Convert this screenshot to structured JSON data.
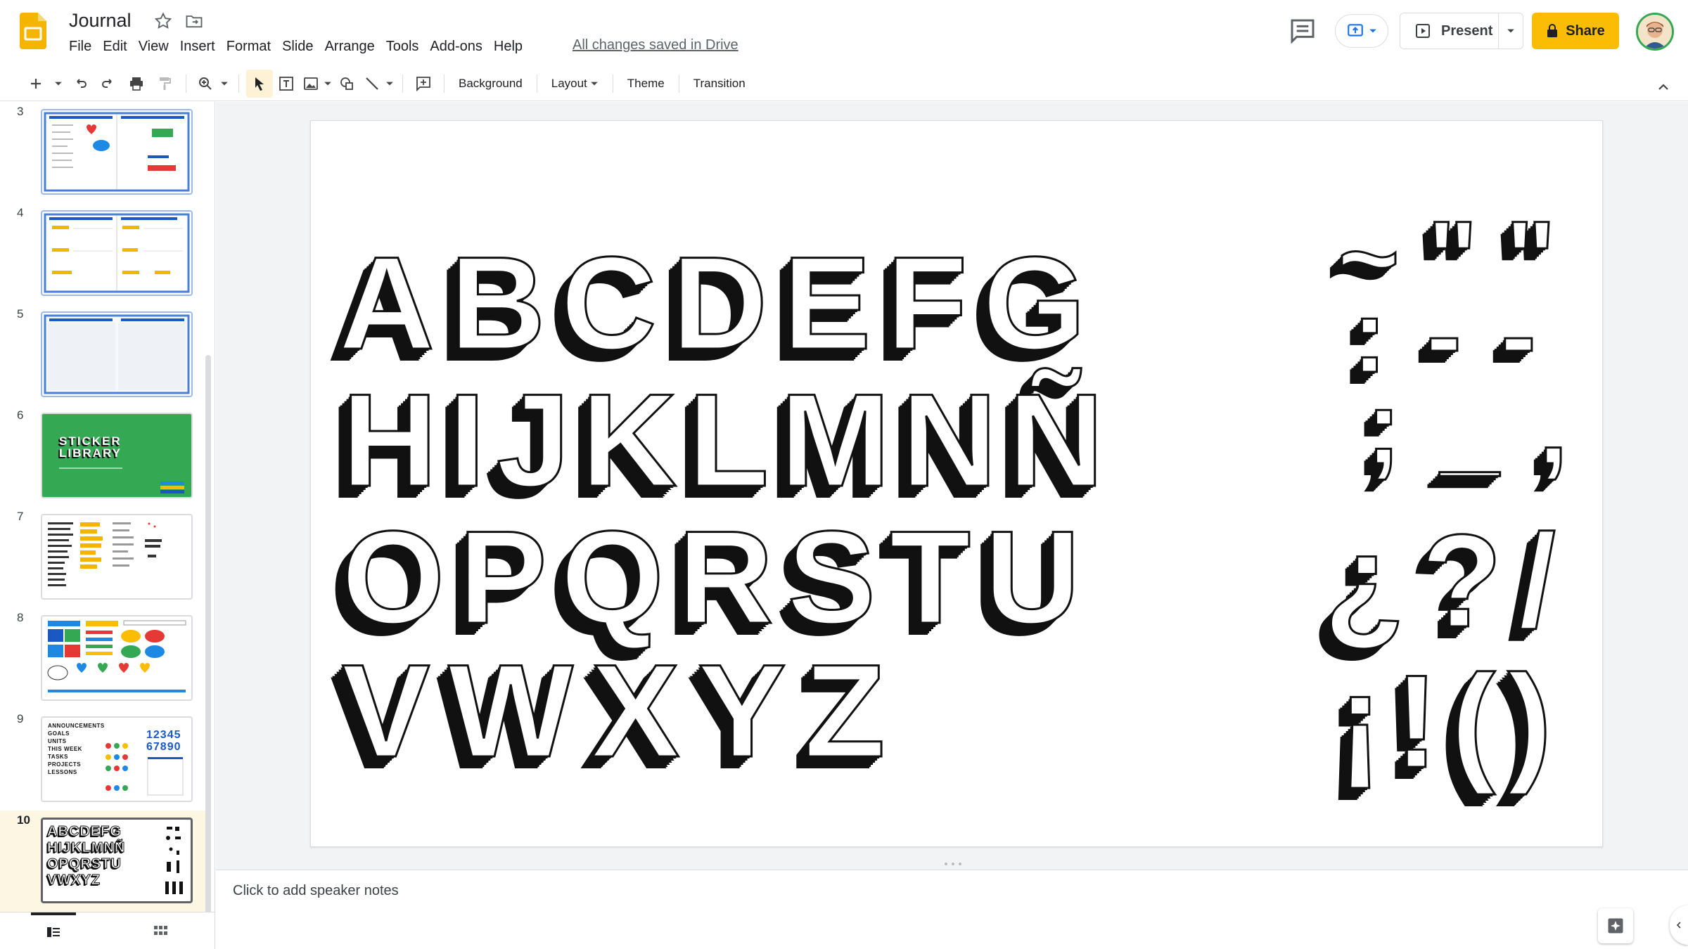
{
  "app": {
    "title": "Journal",
    "saved_status": "All changes saved in Drive",
    "brand_color": "#f4b400"
  },
  "menu": [
    "File",
    "Edit",
    "View",
    "Insert",
    "Format",
    "Slide",
    "Arrange",
    "Tools",
    "Add-ons",
    "Help"
  ],
  "header_buttons": {
    "present_label": "Present",
    "share_label": "Share",
    "share_color": "#fbbc04"
  },
  "toolbar": {
    "background_label": "Background",
    "layout_label": "Layout",
    "theme_label": "Theme",
    "transition_label": "Transition"
  },
  "filmstrip": {
    "slides": [
      {
        "number": "3"
      },
      {
        "number": "4"
      },
      {
        "number": "5"
      },
      {
        "number": "6",
        "title_line1": "STICKER",
        "title_line2": "LIBRARY",
        "bg": "#34a853"
      },
      {
        "number": "7"
      },
      {
        "number": "8"
      },
      {
        "number": "9",
        "digits_line1": "12345",
        "digits_line2": "67890"
      },
      {
        "number": "10"
      }
    ],
    "thumb_texts": {
      "s9_lines": [
        "ANNOUNCEMENTS",
        "GOALS",
        "UNITS",
        "THIS WEEK",
        "TASKS",
        "PROJECTS",
        "LESSONS"
      ],
      "s10_lines": [
        "ABCDEFG",
        "HIJKLMNÑ",
        "OPQRSTU",
        "VWXYZ"
      ]
    }
  },
  "slide": {
    "row1": [
      "A",
      "B",
      "C",
      "D",
      "E",
      "F",
      "G"
    ],
    "row2": [
      "H",
      "I",
      "J",
      "K",
      "L",
      "M",
      "N",
      "Ñ"
    ],
    "row3": [
      "O",
      "P",
      "Q",
      "R",
      "S",
      "T",
      "U"
    ],
    "row4": [
      "V",
      "W",
      "X",
      "Y",
      "Z"
    ],
    "symbols_row1": [
      "~",
      "\"",
      "\""
    ],
    "symbols_row2": [
      ":",
      "-",
      "-"
    ],
    "symbols_row3": [
      ";",
      "_",
      ","
    ],
    "symbols_row4": [
      "¿",
      "?",
      "/"
    ],
    "symbols_row5": [
      "¡",
      "!",
      "(",
      ")"
    ]
  },
  "notes": {
    "placeholder": "Click to add speaker notes"
  }
}
